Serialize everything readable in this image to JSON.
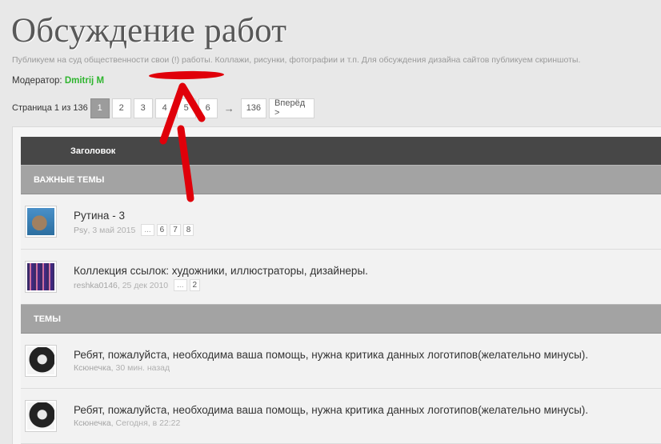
{
  "forum": {
    "title": "Обсуждение работ",
    "description": "Публикуем на суд общественности свои (!) работы. Коллажи, рисунки, фотографии и т.п. Для обсуждения дизайна сайтов публикуем скриншоты.",
    "moderator_label": "Модератор:",
    "moderator_name": "Dmitrij M"
  },
  "pagination": {
    "label": "Страница 1 из 136",
    "pages": [
      "1",
      "2",
      "3",
      "4",
      "5",
      "6"
    ],
    "current": "1",
    "arrow": "→",
    "last": "136",
    "next_label": "Вперёд >"
  },
  "table": {
    "header": "Заголовок",
    "sections": [
      {
        "label": "ВАЖНЫЕ ТЕМЫ",
        "topics": [
          {
            "title": "Рутина - 3",
            "author": "Psy",
            "date": "3 май 2015",
            "pages": [
              "...",
              "6",
              "7",
              "8"
            ],
            "avatar": "cat-avatar"
          },
          {
            "title": "Коллекция ссылок: художники, иллюстраторы, дизайнеры.",
            "author": "reshka0146",
            "date": "25 дек 2010",
            "pages": [
              "...",
              "2"
            ],
            "avatar": "church-avatar"
          }
        ]
      },
      {
        "label": "ТЕМЫ",
        "topics": [
          {
            "title": "Ребят, пожалуйста, необходима ваша помощь, нужна критика данных логотипов(желательно минусы).",
            "author": "Ксюнечка",
            "date": "30 мин. назад",
            "pages": [],
            "avatar": "girl-avatar"
          },
          {
            "title": "Ребят, пожалуйста, необходима ваша помощь, нужна критика данных логотипов(желательно минусы).",
            "author": "Ксюнечка",
            "date": "Сегодня, в 22:22",
            "pages": [],
            "avatar": "girl-avatar"
          }
        ]
      }
    ]
  },
  "colors": {
    "annotation": "#e0000a",
    "moderator": "#2fb52f",
    "header_bg": "#474747",
    "section_bg": "#a3a3a3"
  }
}
